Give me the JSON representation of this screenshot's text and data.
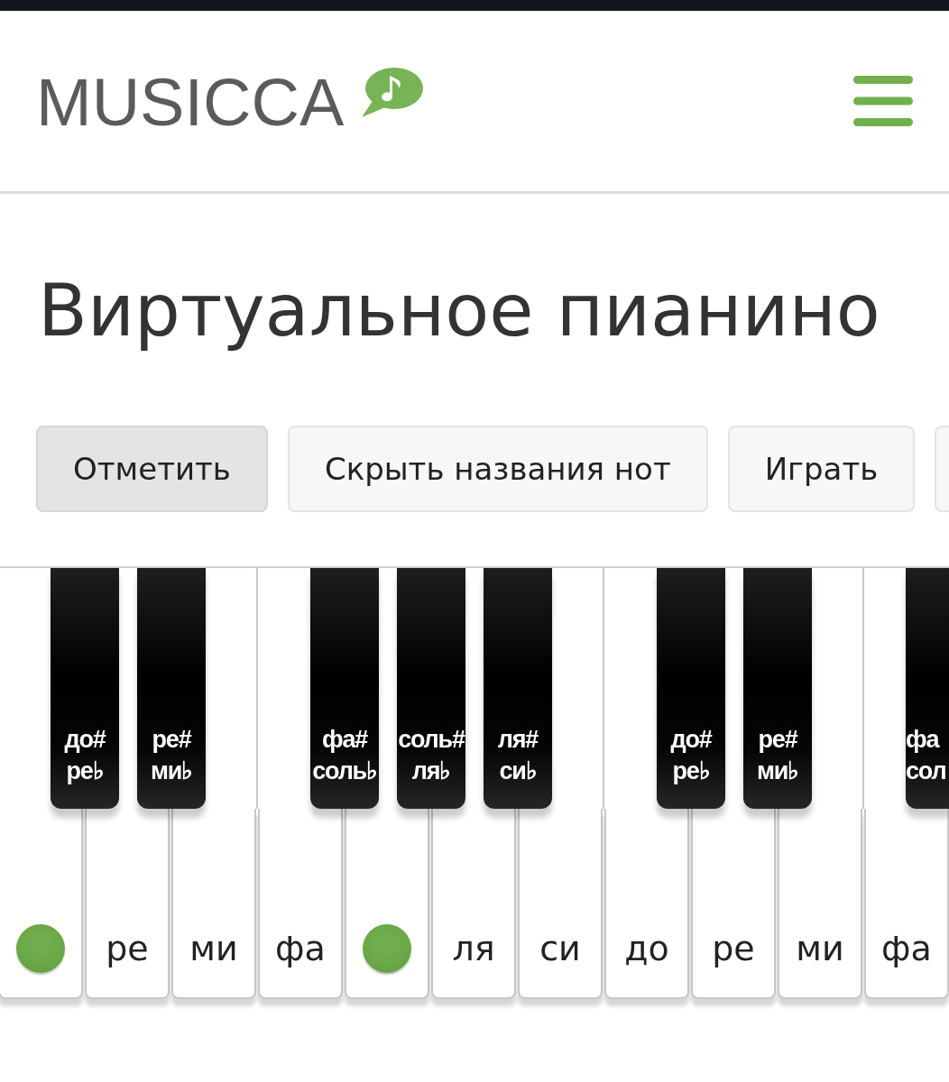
{
  "header": {
    "logo": "MUSICCA"
  },
  "title": "Виртуальное пианино",
  "buttons": [
    {
      "label": "Отметить",
      "selected": true
    },
    {
      "label": "Скрыть названия нот",
      "selected": false
    },
    {
      "label": "Играть",
      "selected": false
    }
  ],
  "keyboard": {
    "white_keys": [
      {
        "marked": true,
        "black_key": {
          "labels": [
            "до#",
            "ре♭"
          ]
        }
      },
      {
        "label": "ре",
        "marked": false,
        "black_key": {
          "labels": [
            "ре#",
            "ми♭"
          ]
        }
      },
      {
        "label": "ми",
        "marked": false
      },
      {
        "label": "фа",
        "marked": false,
        "black_key": {
          "labels": [
            "фа#",
            "соль♭"
          ]
        }
      },
      {
        "marked": true,
        "black_key": {
          "labels": [
            "соль#",
            "ля♭"
          ]
        }
      },
      {
        "label": "ля",
        "marked": false,
        "black_key": {
          "labels": [
            "ля#",
            "си♭"
          ]
        }
      },
      {
        "label": "си",
        "marked": false
      },
      {
        "label": "до",
        "marked": false,
        "black_key": {
          "labels": [
            "до#",
            "ре♭"
          ]
        }
      },
      {
        "label": "ре",
        "marked": false,
        "black_key": {
          "labels": [
            "ре#",
            "ми♭"
          ]
        }
      },
      {
        "label": "ми",
        "marked": false
      },
      {
        "label": "фа",
        "marked": false,
        "black_key": {
          "labels": [
            "фа",
            "сол"
          ]
        }
      }
    ]
  }
}
